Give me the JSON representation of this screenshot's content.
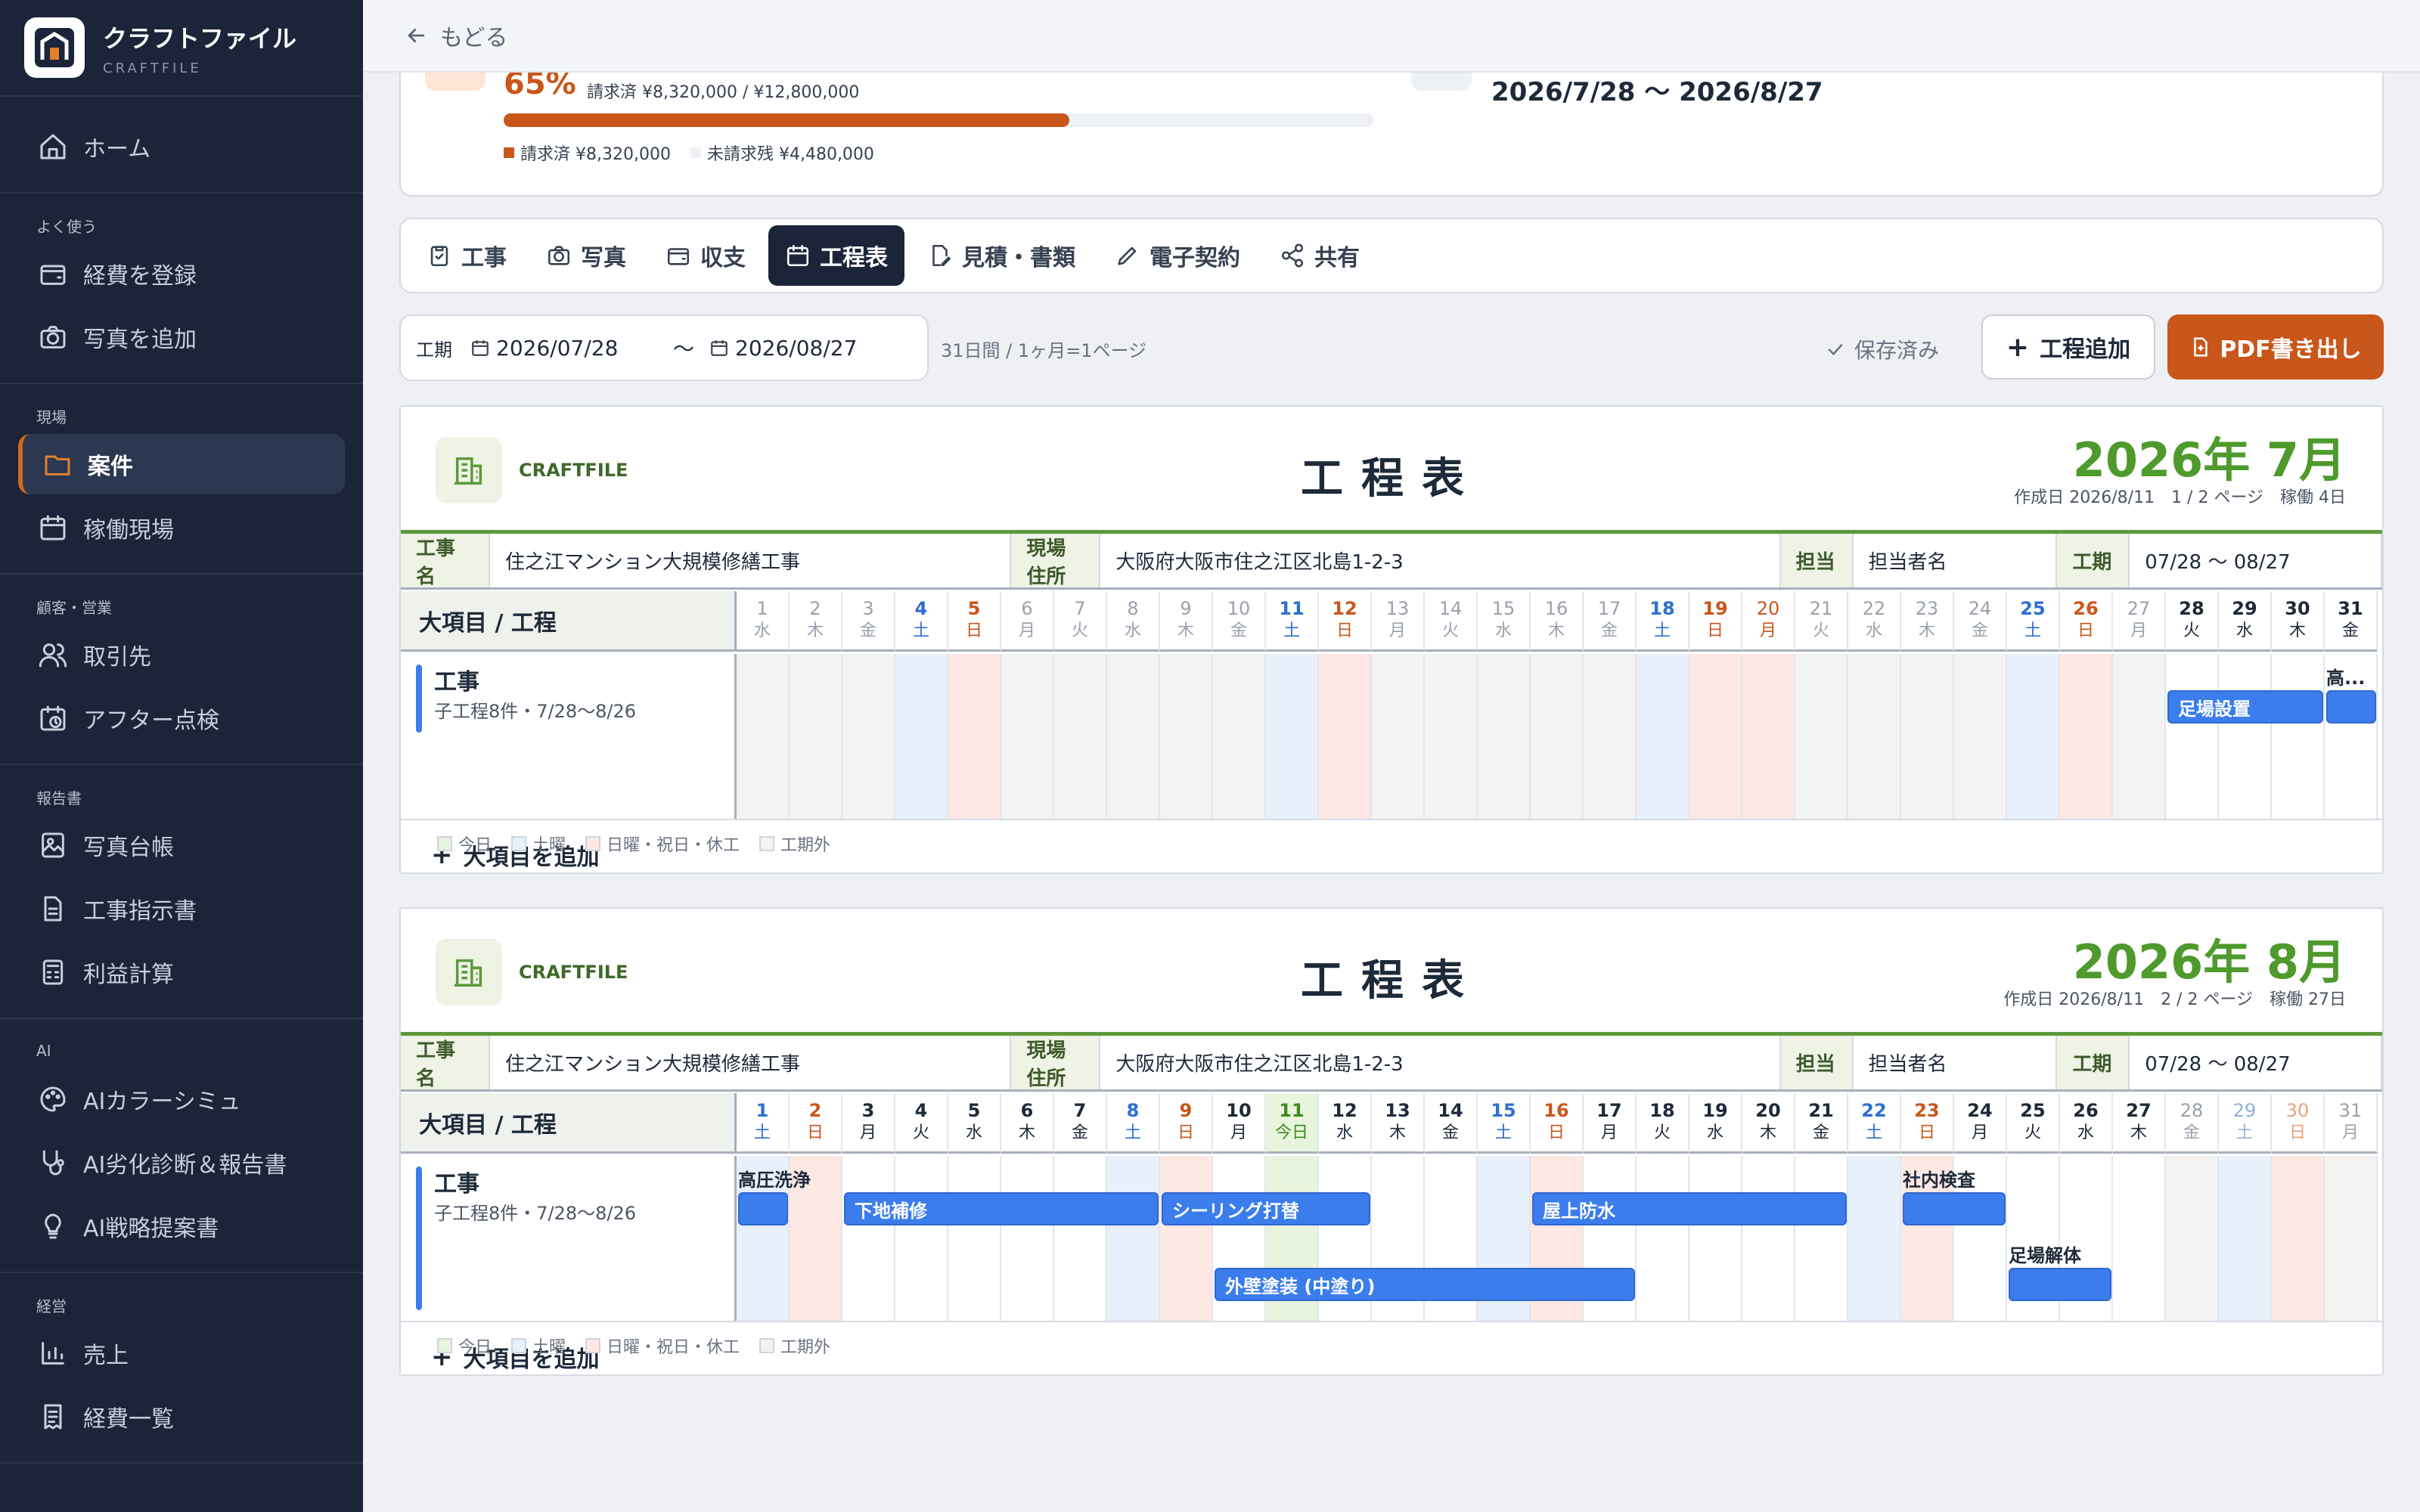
{
  "brand": {
    "name": "クラフトファイル",
    "sub": "CRAFTFILE"
  },
  "nav": [
    {
      "items": [
        {
          "label": "ホーム",
          "icon": "home-icon"
        }
      ]
    },
    {
      "title": "よく使う",
      "items": [
        {
          "label": "経費を登録",
          "icon": "wallet-icon"
        },
        {
          "label": "写真を追加",
          "icon": "camera-icon"
        }
      ]
    },
    {
      "title": "現場",
      "items": [
        {
          "label": "案件",
          "icon": "folder-icon",
          "active": true
        },
        {
          "label": "稼働現場",
          "icon": "calendar-icon"
        }
      ]
    },
    {
      "title": "顧客・営業",
      "items": [
        {
          "label": "取引先",
          "icon": "users-icon"
        },
        {
          "label": "アフター点検",
          "icon": "calendar-clock-icon"
        }
      ]
    },
    {
      "title": "報告書",
      "items": [
        {
          "label": "写真台帳",
          "icon": "image-book-icon"
        },
        {
          "label": "工事指示書",
          "icon": "document-icon"
        },
        {
          "label": "利益計算",
          "icon": "calculator-icon"
        }
      ]
    },
    {
      "title": "AI",
      "items": [
        {
          "label": "AIカラーシミュ",
          "icon": "palette-icon"
        },
        {
          "label": "AI劣化診断＆報告書",
          "icon": "stethoscope-icon"
        },
        {
          "label": "AI戦略提案書",
          "icon": "lightbulb-icon"
        }
      ]
    },
    {
      "title": "経営",
      "items": [
        {
          "label": "売上",
          "icon": "bar-chart-icon"
        },
        {
          "label": "経費一覧",
          "icon": "receipt-icon"
        }
      ]
    }
  ],
  "topbar": {
    "back": "もどる"
  },
  "summary": {
    "percent": "65%",
    "billed_text": "請求済 ¥8,320,000 / ¥12,800,000",
    "progress": 0.65,
    "legend_billed": "請求済 ¥8,320,000",
    "legend_remaining": "未請求残 ¥4,480,000",
    "period": "2026/7/28 〜 2026/8/27"
  },
  "tabs": [
    {
      "label": "工事",
      "icon": "clipboard-icon"
    },
    {
      "label": "写真",
      "icon": "camera-icon"
    },
    {
      "label": "収支",
      "icon": "wallet-icon"
    },
    {
      "label": "工程表",
      "icon": "calendar-icon",
      "active": true
    },
    {
      "label": "見積・書類",
      "icon": "document-edit-icon"
    },
    {
      "label": "電子契約",
      "icon": "pen-icon"
    },
    {
      "label": "共有",
      "icon": "share-icon"
    }
  ],
  "toolbar": {
    "period_label": "工期",
    "start": "2026/07/28",
    "tilde": "〜",
    "end": "2026/08/27",
    "note": "31日間 / 1ヶ月=1ページ",
    "saved": "保存済み",
    "add_label": "工程追加",
    "pdf_label": "PDF書き出し"
  },
  "colors": {
    "accent": "#c9561a",
    "nav_bg": "#1b2438",
    "bar": "#3b7ded",
    "green": "#4e9a2c"
  },
  "sheets": [
    {
      "brand": "CRAFTFILE",
      "title": "工程表",
      "month": "2026年 7月",
      "meta": "作成日 2026/8/11　1 / 2 ページ　稼働 4日",
      "info": {
        "l1": "工事名",
        "v1": "住之江マンション大規模修繕工事",
        "l2": "現場住所",
        "v2": "大阪府大阪市住之江区北島1-2-3",
        "l3": "担当",
        "v3": "担当者名",
        "l4": "工期",
        "v4": "07/28 〜 08/27"
      },
      "grid_head": "大項目 / 工程",
      "group": {
        "name": "工事",
        "sub": "子工程8件・7/28〜8/26"
      },
      "days": [
        {
          "n": "1",
          "w": "水",
          "t": "out"
        },
        {
          "n": "2",
          "w": "木",
          "t": "out"
        },
        {
          "n": "3",
          "w": "金",
          "t": "out"
        },
        {
          "n": "4",
          "w": "土",
          "t": "sat"
        },
        {
          "n": "5",
          "w": "日",
          "t": "sun"
        },
        {
          "n": "6",
          "w": "月",
          "t": "out"
        },
        {
          "n": "7",
          "w": "火",
          "t": "out"
        },
        {
          "n": "8",
          "w": "水",
          "t": "out"
        },
        {
          "n": "9",
          "w": "木",
          "t": "out"
        },
        {
          "n": "10",
          "w": "金",
          "t": "out"
        },
        {
          "n": "11",
          "w": "土",
          "t": "sat"
        },
        {
          "n": "12",
          "w": "日",
          "t": "sun"
        },
        {
          "n": "13",
          "w": "月",
          "t": "out"
        },
        {
          "n": "14",
          "w": "火",
          "t": "out"
        },
        {
          "n": "15",
          "w": "水",
          "t": "out"
        },
        {
          "n": "16",
          "w": "木",
          "t": "out"
        },
        {
          "n": "17",
          "w": "金",
          "t": "out"
        },
        {
          "n": "18",
          "w": "土",
          "t": "sat"
        },
        {
          "n": "19",
          "w": "日",
          "t": "sun"
        },
        {
          "n": "20",
          "w": "月",
          "t": "hol"
        },
        {
          "n": "21",
          "w": "火",
          "t": "out"
        },
        {
          "n": "22",
          "w": "水",
          "t": "out"
        },
        {
          "n": "23",
          "w": "木",
          "t": "out"
        },
        {
          "n": "24",
          "w": "金",
          "t": "out"
        },
        {
          "n": "25",
          "w": "土",
          "t": "sat"
        },
        {
          "n": "26",
          "w": "日",
          "t": "sun"
        },
        {
          "n": "27",
          "w": "月",
          "t": "out"
        },
        {
          "n": "28",
          "w": "火",
          "t": "work"
        },
        {
          "n": "29",
          "w": "水",
          "t": "work"
        },
        {
          "n": "30",
          "w": "木",
          "t": "work"
        },
        {
          "n": "31",
          "w": "金",
          "t": "work"
        }
      ],
      "tasks": [
        {
          "label": "足場設置",
          "start": 28,
          "end": 30,
          "row": 1,
          "inside": true
        },
        {
          "label": "高...",
          "start": 31,
          "end": 31,
          "row": 1,
          "inside": false
        }
      ],
      "add_group": "大項目を追加",
      "legend": [
        "今日",
        "土曜",
        "日曜・祝日・休工",
        "工期外"
      ]
    },
    {
      "brand": "CRAFTFILE",
      "title": "工程表",
      "month": "2026年 8月",
      "meta": "作成日 2026/8/11　2 / 2 ページ　稼働 27日",
      "info": {
        "l1": "工事名",
        "v1": "住之江マンション大規模修繕工事",
        "l2": "現場住所",
        "v2": "大阪府大阪市住之江区北島1-2-3",
        "l3": "担当",
        "v3": "担当者名",
        "l4": "工期",
        "v4": "07/28 〜 08/27"
      },
      "grid_head": "大項目 / 工程",
      "group": {
        "name": "工事",
        "sub": "子工程8件・7/28〜8/26"
      },
      "days": [
        {
          "n": "1",
          "w": "土",
          "t": "sat"
        },
        {
          "n": "2",
          "w": "日",
          "t": "sun"
        },
        {
          "n": "3",
          "w": "月",
          "t": "work"
        },
        {
          "n": "4",
          "w": "火",
          "t": "work"
        },
        {
          "n": "5",
          "w": "水",
          "t": "work"
        },
        {
          "n": "6",
          "w": "木",
          "t": "work"
        },
        {
          "n": "7",
          "w": "金",
          "t": "work"
        },
        {
          "n": "8",
          "w": "土",
          "t": "sat"
        },
        {
          "n": "9",
          "w": "日",
          "t": "sun"
        },
        {
          "n": "10",
          "w": "月",
          "t": "work"
        },
        {
          "n": "11",
          "w": "今日",
          "t": "today"
        },
        {
          "n": "12",
          "w": "水",
          "t": "work"
        },
        {
          "n": "13",
          "w": "木",
          "t": "work"
        },
        {
          "n": "14",
          "w": "金",
          "t": "work"
        },
        {
          "n": "15",
          "w": "土",
          "t": "sat"
        },
        {
          "n": "16",
          "w": "日",
          "t": "sun"
        },
        {
          "n": "17",
          "w": "月",
          "t": "work"
        },
        {
          "n": "18",
          "w": "火",
          "t": "work"
        },
        {
          "n": "19",
          "w": "水",
          "t": "work"
        },
        {
          "n": "20",
          "w": "木",
          "t": "work"
        },
        {
          "n": "21",
          "w": "金",
          "t": "work"
        },
        {
          "n": "22",
          "w": "土",
          "t": "sat"
        },
        {
          "n": "23",
          "w": "日",
          "t": "sun"
        },
        {
          "n": "24",
          "w": "月",
          "t": "work"
        },
        {
          "n": "25",
          "w": "火",
          "t": "work"
        },
        {
          "n": "26",
          "w": "水",
          "t": "work"
        },
        {
          "n": "27",
          "w": "木",
          "t": "work"
        },
        {
          "n": "28",
          "w": "金",
          "t": "out"
        },
        {
          "n": "29",
          "w": "土",
          "t": "outsat"
        },
        {
          "n": "30",
          "w": "日",
          "t": "outsun"
        },
        {
          "n": "31",
          "w": "月",
          "t": "out"
        }
      ],
      "tasks": [
        {
          "label": "高圧洗浄",
          "start": 1,
          "end": 1,
          "row": 1,
          "inside": false
        },
        {
          "label": "下地補修",
          "start": 3,
          "end": 8,
          "row": 1,
          "inside": true
        },
        {
          "label": "シーリング打替",
          "start": 9,
          "end": 12,
          "row": 1,
          "inside": true
        },
        {
          "label": "屋上防水",
          "start": 16,
          "end": 21,
          "row": 1,
          "inside": true
        },
        {
          "label": "社内検査",
          "start": 23,
          "end": 24,
          "row": 1,
          "inside": false
        },
        {
          "label": "外壁塗装 (中塗り)",
          "start": 10,
          "end": 17,
          "row": 2,
          "inside": true
        },
        {
          "label": "足場解体",
          "start": 25,
          "end": 26,
          "row": 2,
          "inside": false
        }
      ],
      "add_group": "大項目を追加",
      "legend": [
        "今日",
        "土曜",
        "日曜・祝日・休工",
        "工期外"
      ]
    }
  ]
}
